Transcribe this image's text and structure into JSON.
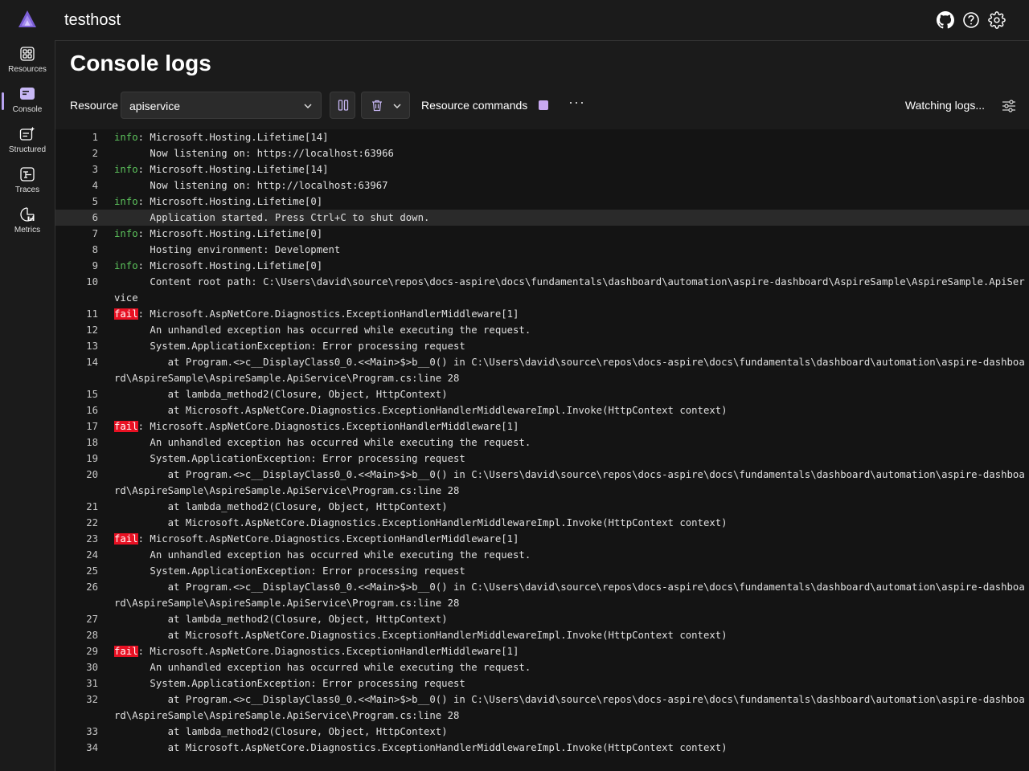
{
  "app": {
    "title": "testhost"
  },
  "nav": [
    {
      "label": "Resources",
      "icon": "resources-grid-icon"
    },
    {
      "label": "Console",
      "icon": "console-icon",
      "active": true
    },
    {
      "label": "Structured",
      "icon": "structured-logs-icon"
    },
    {
      "label": "Traces",
      "icon": "traces-icon"
    },
    {
      "label": "Metrics",
      "icon": "metrics-icon"
    }
  ],
  "header_icons": [
    "github-icon",
    "help-icon",
    "settings-gear-icon"
  ],
  "page": {
    "title": "Console logs"
  },
  "toolbar": {
    "resource_label": "Resource",
    "resource_value": "apiservice",
    "resource_commands_label": "Resource commands",
    "status": "Watching logs..."
  },
  "colors": {
    "info": "#5cc25c",
    "fail_bg": "#e81123",
    "accent": "#b8a3f0"
  },
  "logs": [
    {
      "n": "1",
      "level": "info",
      "text": ": Microsoft.Hosting.Lifetime[14]"
    },
    {
      "n": "2",
      "text": "      Now listening on: https://localhost:63966"
    },
    {
      "n": "3",
      "level": "info",
      "text": ": Microsoft.Hosting.Lifetime[14]"
    },
    {
      "n": "4",
      "text": "      Now listening on: http://localhost:63967"
    },
    {
      "n": "5",
      "level": "info",
      "text": ": Microsoft.Hosting.Lifetime[0]"
    },
    {
      "n": "6",
      "text": "      Application started. Press Ctrl+C to shut down.",
      "highlight": true
    },
    {
      "n": "7",
      "level": "info",
      "text": ": Microsoft.Hosting.Lifetime[0]"
    },
    {
      "n": "8",
      "text": "      Hosting environment: Development"
    },
    {
      "n": "9",
      "level": "info",
      "text": ": Microsoft.Hosting.Lifetime[0]"
    },
    {
      "n": "10",
      "text": "      Content root path: C:\\Users\\david\\source\\repos\\docs-aspire\\docs\\fundamentals\\dashboard\\automation\\aspire-dashboard\\AspireSample\\AspireSample.ApiService"
    },
    {
      "n": "11",
      "level": "fail",
      "text": ": Microsoft.AspNetCore.Diagnostics.ExceptionHandlerMiddleware[1]"
    },
    {
      "n": "12",
      "text": "      An unhandled exception has occurred while executing the request."
    },
    {
      "n": "13",
      "text": "      System.ApplicationException: Error processing request"
    },
    {
      "n": "14",
      "text": "         at Program.<>c__DisplayClass0_0.<<Main>$>b__0() in C:\\Users\\david\\source\\repos\\docs-aspire\\docs\\fundamentals\\dashboard\\automation\\aspire-dashboard\\AspireSample\\AspireSample.ApiService\\Program.cs:line 28"
    },
    {
      "n": "15",
      "text": "         at lambda_method2(Closure, Object, HttpContext)"
    },
    {
      "n": "16",
      "text": "         at Microsoft.AspNetCore.Diagnostics.ExceptionHandlerMiddlewareImpl.Invoke(HttpContext context)"
    },
    {
      "n": "17",
      "level": "fail",
      "text": ": Microsoft.AspNetCore.Diagnostics.ExceptionHandlerMiddleware[1]"
    },
    {
      "n": "18",
      "text": "      An unhandled exception has occurred while executing the request."
    },
    {
      "n": "19",
      "text": "      System.ApplicationException: Error processing request"
    },
    {
      "n": "20",
      "text": "         at Program.<>c__DisplayClass0_0.<<Main>$>b__0() in C:\\Users\\david\\source\\repos\\docs-aspire\\docs\\fundamentals\\dashboard\\automation\\aspire-dashboard\\AspireSample\\AspireSample.ApiService\\Program.cs:line 28"
    },
    {
      "n": "21",
      "text": "         at lambda_method2(Closure, Object, HttpContext)"
    },
    {
      "n": "22",
      "text": "         at Microsoft.AspNetCore.Diagnostics.ExceptionHandlerMiddlewareImpl.Invoke(HttpContext context)"
    },
    {
      "n": "23",
      "level": "fail",
      "text": ": Microsoft.AspNetCore.Diagnostics.ExceptionHandlerMiddleware[1]"
    },
    {
      "n": "24",
      "text": "      An unhandled exception has occurred while executing the request."
    },
    {
      "n": "25",
      "text": "      System.ApplicationException: Error processing request"
    },
    {
      "n": "26",
      "text": "         at Program.<>c__DisplayClass0_0.<<Main>$>b__0() in C:\\Users\\david\\source\\repos\\docs-aspire\\docs\\fundamentals\\dashboard\\automation\\aspire-dashboard\\AspireSample\\AspireSample.ApiService\\Program.cs:line 28"
    },
    {
      "n": "27",
      "text": "         at lambda_method2(Closure, Object, HttpContext)"
    },
    {
      "n": "28",
      "text": "         at Microsoft.AspNetCore.Diagnostics.ExceptionHandlerMiddlewareImpl.Invoke(HttpContext context)"
    },
    {
      "n": "29",
      "level": "fail",
      "text": ": Microsoft.AspNetCore.Diagnostics.ExceptionHandlerMiddleware[1]"
    },
    {
      "n": "30",
      "text": "      An unhandled exception has occurred while executing the request."
    },
    {
      "n": "31",
      "text": "      System.ApplicationException: Error processing request"
    },
    {
      "n": "32",
      "text": "         at Program.<>c__DisplayClass0_0.<<Main>$>b__0() in C:\\Users\\david\\source\\repos\\docs-aspire\\docs\\fundamentals\\dashboard\\automation\\aspire-dashboard\\AspireSample\\AspireSample.ApiService\\Program.cs:line 28"
    },
    {
      "n": "33",
      "text": "         at lambda_method2(Closure, Object, HttpContext)"
    },
    {
      "n": "34",
      "text": "         at Microsoft.AspNetCore.Diagnostics.ExceptionHandlerMiddlewareImpl.Invoke(HttpContext context)"
    }
  ]
}
